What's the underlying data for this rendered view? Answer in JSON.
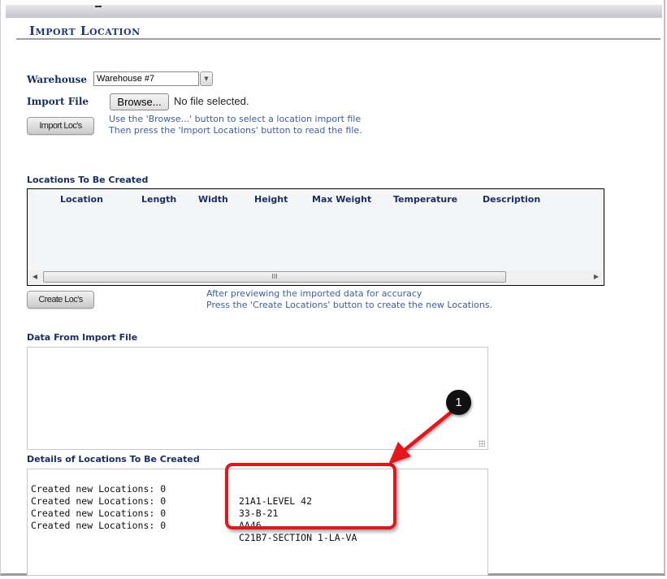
{
  "page": {
    "title": "Import Location"
  },
  "form": {
    "warehouse_label": "Warehouse",
    "warehouse_value": "Warehouse #7",
    "import_file_label": "Import File",
    "browse_button": "Browse...",
    "file_status": "No file selected.",
    "import_button": "Import Loc's",
    "import_hint_line1": "Use the 'Browse...' button to select a location import file",
    "import_hint_line2": "Then press the 'Import Locations' button to read the file."
  },
  "locations_grid": {
    "label": "Locations To Be Created",
    "columns": [
      "Location",
      "Length",
      "Width",
      "Height",
      "Max Weight",
      "Temperature",
      "Description"
    ],
    "rows": [],
    "scroll_left_icon": "scroll-left-arrow",
    "scroll_right_icon": "scroll-right-arrow",
    "thumb_grip": "III"
  },
  "create": {
    "button": "Create Loc's",
    "hint_line1": "After previewing the imported data for accuracy",
    "hint_line2": "Press the 'Create Locations' button to create the new Locations."
  },
  "import_data": {
    "label": "Data From Import File",
    "value": ""
  },
  "details": {
    "label": "Details of Locations To Be Created",
    "rows": [
      {
        "status": "Created new Locations: 0",
        "location": "21A1-LEVEL 42"
      },
      {
        "status": "Created new Locations: 0",
        "location": "33-B-21"
      },
      {
        "status": "Created new Locations: 0",
        "location": "AA46"
      },
      {
        "status": "Created new Locations: 0",
        "location": "C21B7-SECTION 1-LA-VA"
      }
    ]
  },
  "annotation": {
    "callout_number": "1",
    "color": "#e8141a"
  }
}
